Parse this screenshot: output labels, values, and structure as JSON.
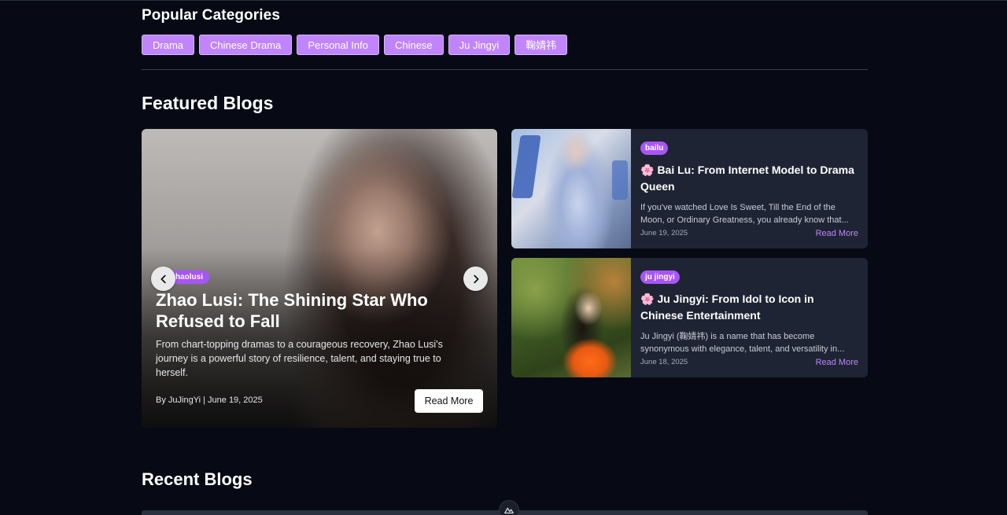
{
  "categories": {
    "title": "Popular Categories",
    "tags": [
      "Drama",
      "Chinese Drama",
      "Personal Info",
      "Chinese",
      "Ju Jingyi",
      "鞠婧祎"
    ]
  },
  "featured": {
    "title": "Featured Blogs",
    "hero": {
      "badge": "zhaolusi",
      "title": "Zhao Lusi: The Shining Star Who Refused to Fall",
      "description": "From chart-topping dramas to a courageous recovery, Zhao Lusi's journey is a powerful story of resilience, talent, and staying true to herself.",
      "meta": "By JuJingYi | June 19, 2025",
      "read_more": "Read More"
    },
    "cards": [
      {
        "badge": "bailu",
        "icon": "cherry-blossom-icon",
        "flower": "🌸",
        "title": "Bai Lu: From Internet Model to Drama Queen",
        "description": "If you've watched Love Is Sweet, Till the End of the Moon, or Ordinary Greatness, you already know that...",
        "date": "June 19, 2025",
        "read_more": "Read More"
      },
      {
        "badge": "ju jingyi",
        "icon": "cherry-blossom-icon",
        "flower": "🌸",
        "title": "Ju Jingyi: From Idol to Icon in Chinese Entertainment",
        "description": "Ju Jingyi (鞠婧祎) is a name that has become synonymous with elegance, talent, and versatility in...",
        "date": "June 18, 2025",
        "read_more": "Read More"
      }
    ]
  },
  "recent": {
    "title": "Recent Blogs"
  },
  "colors": {
    "background": "#070a14",
    "accent": "#a855f7",
    "tag": "#c084fc",
    "card": "#1e2433"
  }
}
